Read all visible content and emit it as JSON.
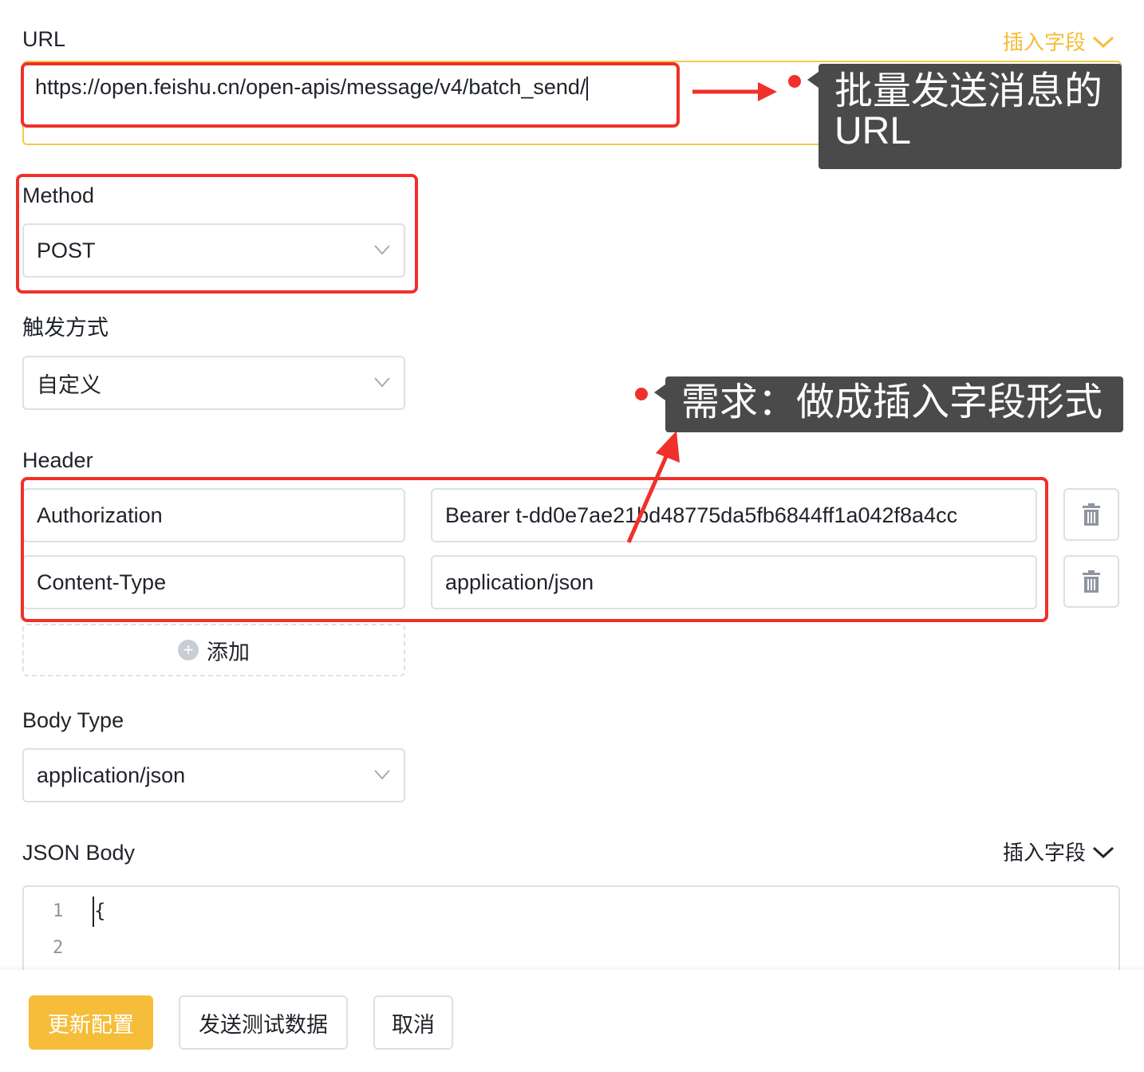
{
  "url_section": {
    "label": "URL",
    "insert_field": "插入字段",
    "value": "https://open.feishu.cn/open-apis/message/v4/batch_send/"
  },
  "method_section": {
    "label": "Method",
    "value": "POST"
  },
  "trigger_section": {
    "label": "触发方式",
    "value": "自定义"
  },
  "header_section": {
    "label": "Header",
    "rows": [
      {
        "key": "Authorization",
        "value": "Bearer t-dd0e7ae21bd48775da5fb6844ff1a042f8a4cc"
      },
      {
        "key": "Content-Type",
        "value": "application/json"
      }
    ],
    "add_label": "添加"
  },
  "body_type_section": {
    "label": "Body Type",
    "value": "application/json"
  },
  "json_body_section": {
    "label": "JSON Body",
    "insert_field": "插入字段",
    "lines": [
      {
        "num": "1",
        "code": "{"
      },
      {
        "num": "2",
        "code": ""
      }
    ]
  },
  "footer": {
    "update_label": "更新配置",
    "send_test_label": "发送测试数据",
    "cancel_label": "取消"
  },
  "annotations": {
    "url_note": "批量发送消息的URL",
    "header_note": "需求：做成插入字段形式"
  },
  "colors": {
    "accent": "#f5bd3a",
    "annotation_red": "#f0302a",
    "tooltip_bg": "#4a4a4a",
    "border": "#dee0e3"
  }
}
